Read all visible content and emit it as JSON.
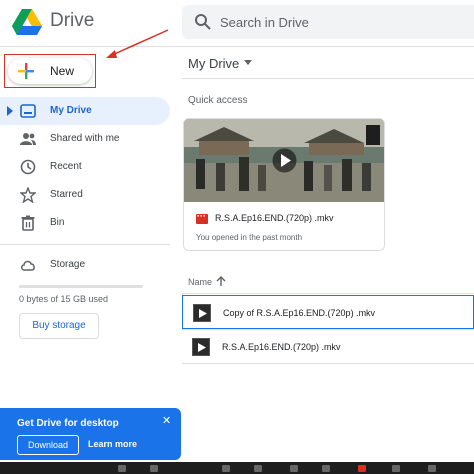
{
  "app": {
    "title": "Drive"
  },
  "search": {
    "placeholder": "Search in Drive"
  },
  "new_button": {
    "label": "New"
  },
  "sidebar": {
    "items": [
      {
        "label": "My Drive",
        "icon": "my-drive-icon",
        "active": true
      },
      {
        "label": "Shared with me",
        "icon": "shared-icon"
      },
      {
        "label": "Recent",
        "icon": "clock-icon"
      },
      {
        "label": "Starred",
        "icon": "star-icon"
      },
      {
        "label": "Bin",
        "icon": "trash-icon"
      }
    ],
    "storage": {
      "label": "Storage",
      "icon": "cloud-icon",
      "used_text": "0 bytes of 15 GB used",
      "used_fraction": 0.0,
      "buy_label": "Buy storage"
    }
  },
  "main": {
    "title": "My Drive",
    "quick_access": {
      "label": "Quick access",
      "card": {
        "file_name": "R.S.A.Ep16.END.(720p) .mkv",
        "subtitle": "You opened in the past month",
        "file_icon": "video-file-icon"
      }
    },
    "list": {
      "column_name": "Name",
      "rows": [
        {
          "name": "Copy of R.S.A.Ep16.END.(720p) .mkv",
          "selected": true
        },
        {
          "name": "R.S.A.Ep16.END.(720p) .mkv",
          "selected": false
        }
      ]
    }
  },
  "promo": {
    "title": "Get Drive for desktop",
    "download_label": "Download",
    "learn_more_label": "Learn more",
    "close_label": "✕"
  },
  "colors": {
    "accent": "#1a73e8",
    "active_bg": "#e8f0fe",
    "annotation_red": "#d93025"
  }
}
